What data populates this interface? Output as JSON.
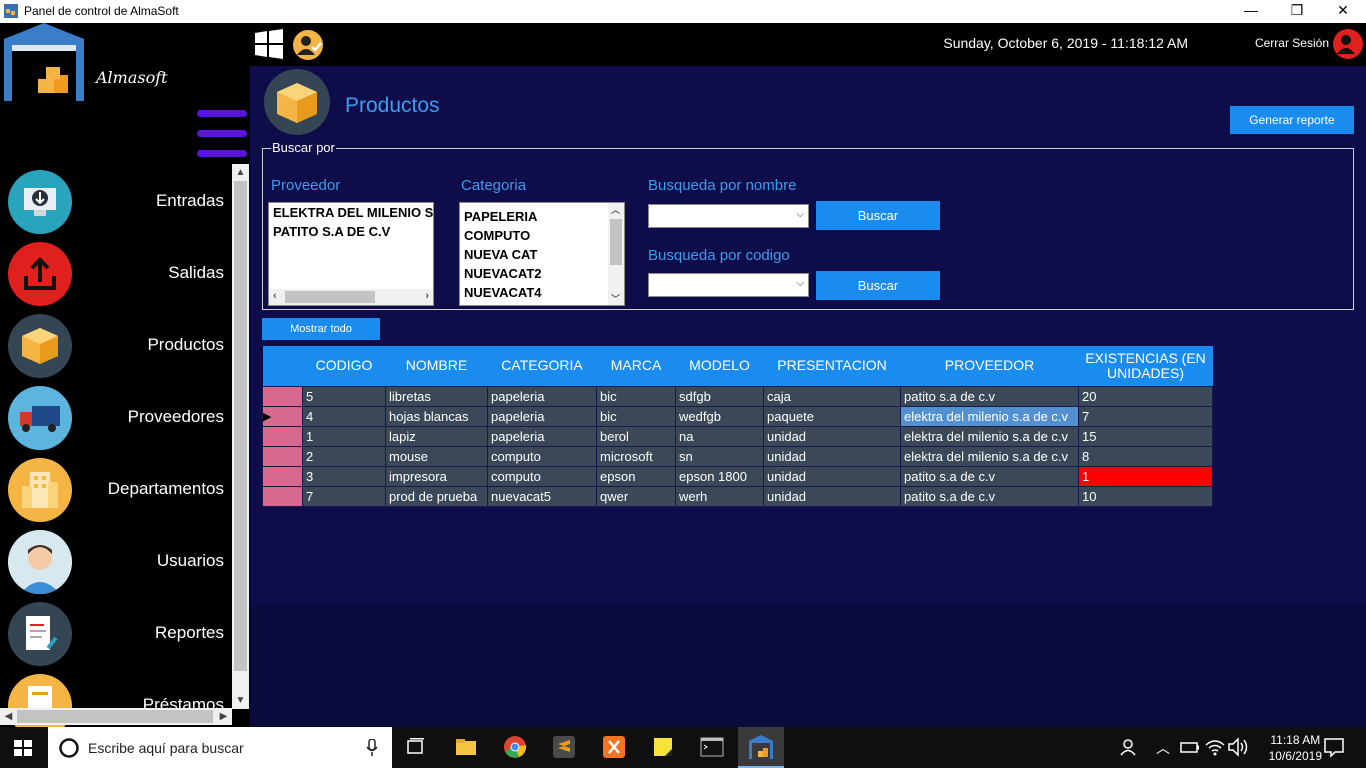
{
  "window": {
    "title": "Panel de control de AlmaSoft",
    "minimize": "—",
    "maximize": "❐",
    "close": "✕"
  },
  "brand": "Almasoft",
  "topbar": {
    "datetime": "Sunday, October 6, 2019 - 11:18:12 AM",
    "logout": "Cerrar Sesión"
  },
  "sidebar": {
    "items": [
      {
        "label": "Entradas",
        "icon": "download-monitor-icon",
        "color": "#2aa3bd"
      },
      {
        "label": "Salidas",
        "icon": "upload-icon",
        "color": "#e0201c"
      },
      {
        "label": "Productos",
        "icon": "box-icon",
        "color": "#344553"
      },
      {
        "label": "Proveedores",
        "icon": "truck-icon",
        "color": "#5bb5de"
      },
      {
        "label": "Departamentos",
        "icon": "building-icon",
        "color": "#f5b545"
      },
      {
        "label": "Usuarios",
        "icon": "user-add-icon",
        "color": "#57bcd8"
      },
      {
        "label": "Reportes",
        "icon": "report-icon",
        "color": "#344553"
      },
      {
        "label": "Préstamos",
        "icon": "loan-icon",
        "color": "#f5b545"
      }
    ]
  },
  "page": {
    "title": "Productos",
    "report_button": "Generar reporte",
    "show_all_button": "Mostrar todo"
  },
  "search": {
    "legend": "Buscar por",
    "provider_label": "Proveedor",
    "providers": [
      "ELEKTRA DEL MILENIO S",
      "PATITO S.A DE C.V"
    ],
    "category_label": "Categoria",
    "categories": [
      "PAPELERIA",
      "COMPUTO",
      "NUEVA CAT",
      "NUEVACAT2",
      "NUEVACAT4"
    ],
    "name_label": "Busqueda por nombre",
    "code_label": "Busqueda por codigo",
    "search_button": "Buscar"
  },
  "table": {
    "headers": [
      "CODIGO",
      "NOMBRE",
      "CATEGORIA",
      "MARCA",
      "MODELO",
      "PRESENTACION",
      "PROVEEDOR",
      "EXISTENCIAS (EN UNIDADES)"
    ],
    "rows": [
      [
        "5",
        "libretas",
        "papeleria",
        "bic",
        "sdfgb",
        "caja",
        "patito s.a de c.v",
        "20"
      ],
      [
        "4",
        "hojas blancas",
        "papeleria",
        "bic",
        "wedfgb",
        "paquete",
        "elektra del milenio s.a de c.v",
        "7"
      ],
      [
        "1",
        "lapiz",
        "papeleria",
        "berol",
        "na",
        "unidad",
        "elektra del milenio s.a de c.v",
        "15"
      ],
      [
        "2",
        "mouse",
        "computo",
        "microsoft",
        "sn",
        "unidad",
        "elektra del milenio s.a de c.v",
        "8"
      ],
      [
        "3",
        "impresora",
        "computo",
        "epson",
        "epson 1800",
        "unidad",
        "patito s.a de c.v",
        "1"
      ],
      [
        "7",
        "prod de prueba",
        "nuevacat5",
        "qwer",
        "werh",
        "unidad",
        "patito s.a de c.v",
        "10"
      ]
    ],
    "current_row_marker": "▶"
  },
  "taskbar": {
    "search_placeholder": "Escribe aquí para buscar",
    "time": "11:18 AM",
    "date": "10/6/2019"
  },
  "colors": {
    "accent": "#1a8cf0",
    "background": "#0e0d4a",
    "alert": "#ff0000",
    "row_header": "#d8698e"
  }
}
